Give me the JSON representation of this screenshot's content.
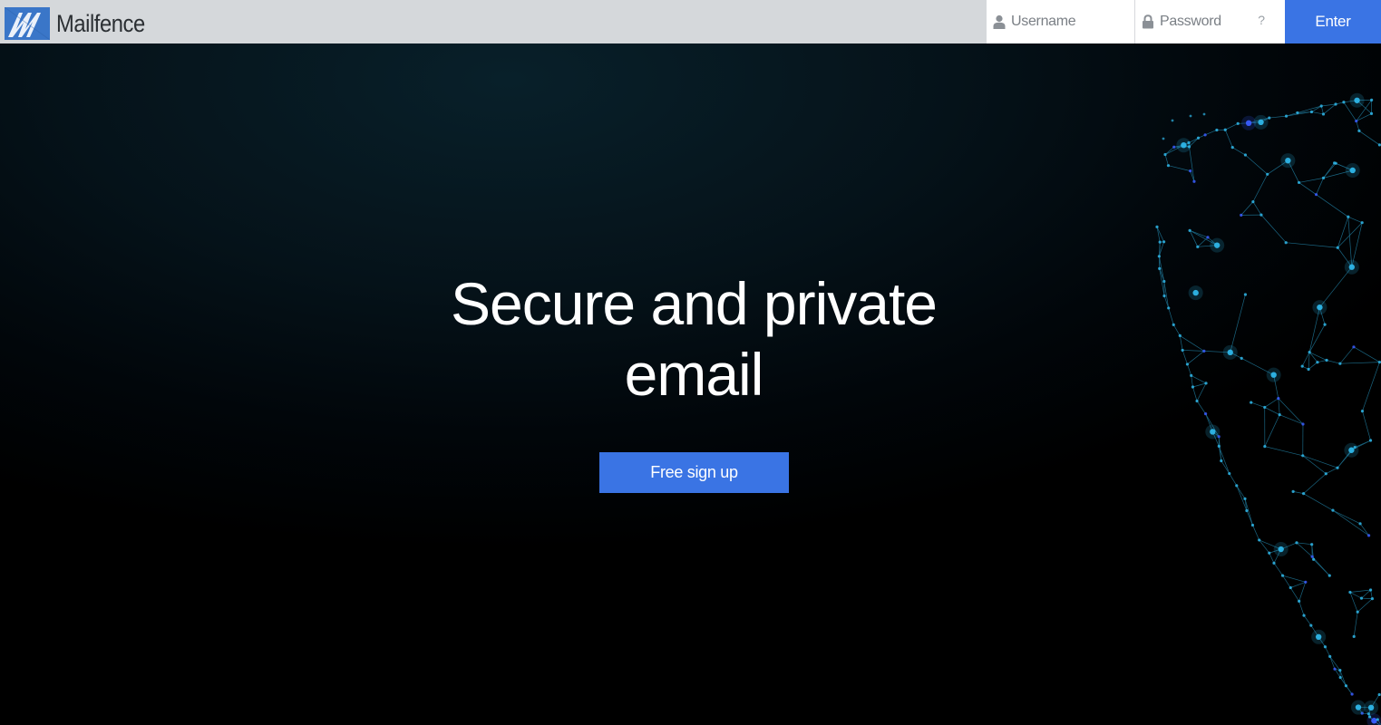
{
  "brand": {
    "name": "Mailfence",
    "logo_icon": "mailfence-logo-icon",
    "logo_color": "#3a76c8"
  },
  "login": {
    "username_placeholder": "Username",
    "password_placeholder": "Password",
    "help_label": "?",
    "enter_label": "Enter",
    "username_icon": "user-icon",
    "password_icon": "lock-icon"
  },
  "hero": {
    "title": "Secure and private email",
    "cta_label": "Free sign up",
    "graphic": "network-shield-graphic"
  },
  "colors": {
    "accent": "#3a74e4",
    "topbar_bg": "#d5d8db",
    "hero_bg": "#051219",
    "network_glow": "#2fb6e8"
  }
}
